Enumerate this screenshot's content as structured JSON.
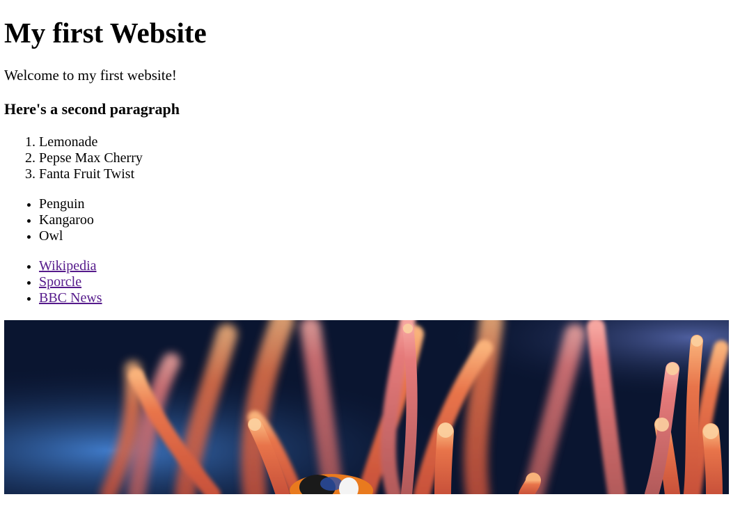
{
  "page": {
    "title": "My first Website",
    "welcome": "Welcome to my first website!",
    "subheading": "Here's a second paragraph"
  },
  "drinks": [
    "Lemonade",
    "Pepse Max Cherry",
    "Fanta Fruit Twist"
  ],
  "animals": [
    "Penguin",
    "Kangaroo",
    "Owl"
  ],
  "links": [
    "Wikipedia",
    "Sporcle",
    "BBC News"
  ],
  "image": {
    "subject": "sea anemone with clownfish",
    "colors": {
      "background": "#0a1530",
      "tentacle": "#e8744a",
      "tentacle_light": "#f9b27a",
      "tentacle_pink": "#e57a7a",
      "glow_blue": "#3c7fd9"
    }
  }
}
